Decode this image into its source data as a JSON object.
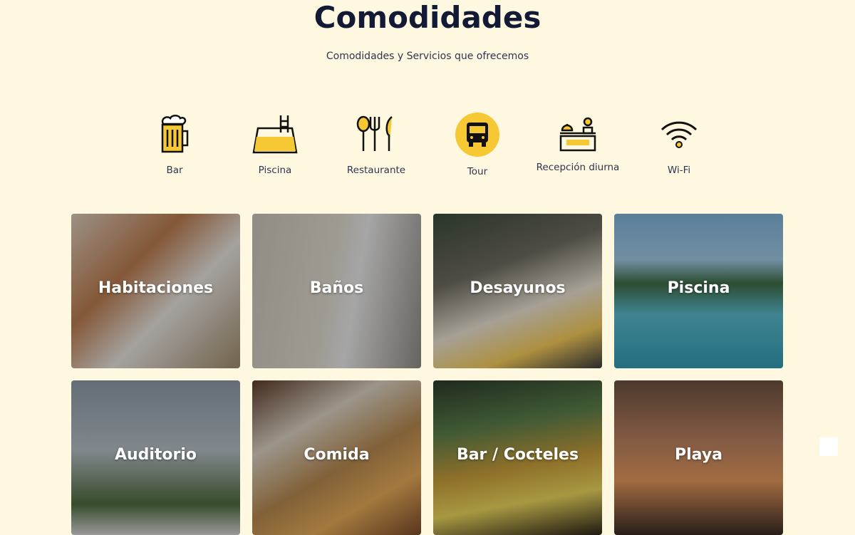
{
  "header": {
    "title": "Comodidades",
    "subtitle": "Comodidades y Servicios que ofrecemos"
  },
  "amenities": [
    {
      "label": "Bar",
      "icon": "beer-mug-icon"
    },
    {
      "label": "Piscina",
      "icon": "pool-icon"
    },
    {
      "label": "Restaurante",
      "icon": "cutlery-icon"
    },
    {
      "label": "Tour",
      "icon": "bus-icon",
      "active": true
    },
    {
      "label": "Recepción diurna",
      "icon": "reception-desk-icon"
    },
    {
      "label": "Wi-Fi",
      "icon": "wifi-icon"
    }
  ],
  "cards": [
    {
      "label": "Habitaciones"
    },
    {
      "label": "Baños"
    },
    {
      "label": "Desayunos"
    },
    {
      "label": "Piscina"
    },
    {
      "label": "Auditorio"
    },
    {
      "label": "Comida"
    },
    {
      "label": "Bar / Cocteles"
    },
    {
      "label": "Playa"
    }
  ],
  "colors": {
    "background": "#fff8e1",
    "accent": "#f6c934",
    "heading": "#121a35"
  }
}
